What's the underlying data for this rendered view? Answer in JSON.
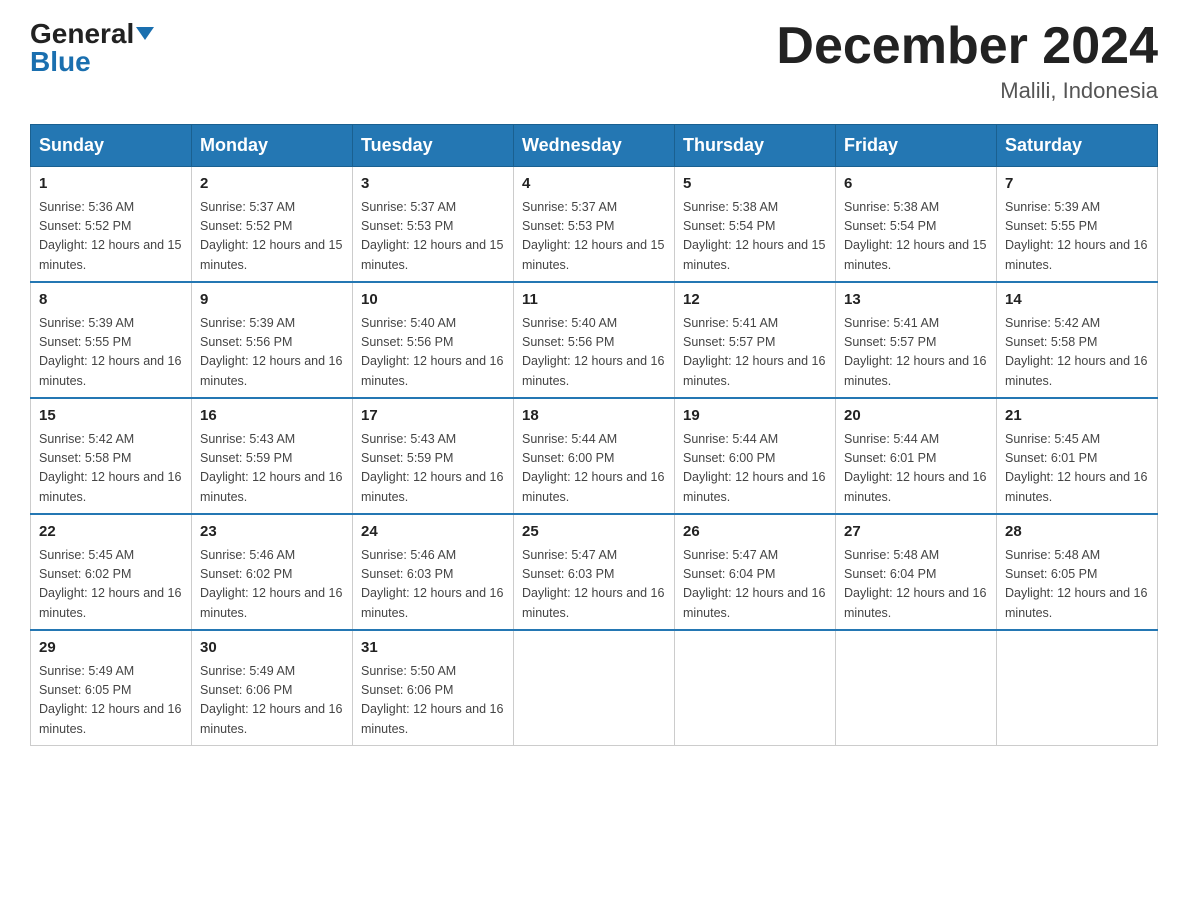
{
  "logo": {
    "line1": "General",
    "line2": "Blue"
  },
  "title": "December 2024",
  "subtitle": "Malili, Indonesia",
  "days_header": [
    "Sunday",
    "Monday",
    "Tuesday",
    "Wednesday",
    "Thursday",
    "Friday",
    "Saturday"
  ],
  "weeks": [
    [
      {
        "day": "1",
        "sunrise": "5:36 AM",
        "sunset": "5:52 PM",
        "daylight": "12 hours and 15 minutes."
      },
      {
        "day": "2",
        "sunrise": "5:37 AM",
        "sunset": "5:52 PM",
        "daylight": "12 hours and 15 minutes."
      },
      {
        "day": "3",
        "sunrise": "5:37 AM",
        "sunset": "5:53 PM",
        "daylight": "12 hours and 15 minutes."
      },
      {
        "day": "4",
        "sunrise": "5:37 AM",
        "sunset": "5:53 PM",
        "daylight": "12 hours and 15 minutes."
      },
      {
        "day": "5",
        "sunrise": "5:38 AM",
        "sunset": "5:54 PM",
        "daylight": "12 hours and 15 minutes."
      },
      {
        "day": "6",
        "sunrise": "5:38 AM",
        "sunset": "5:54 PM",
        "daylight": "12 hours and 15 minutes."
      },
      {
        "day": "7",
        "sunrise": "5:39 AM",
        "sunset": "5:55 PM",
        "daylight": "12 hours and 16 minutes."
      }
    ],
    [
      {
        "day": "8",
        "sunrise": "5:39 AM",
        "sunset": "5:55 PM",
        "daylight": "12 hours and 16 minutes."
      },
      {
        "day": "9",
        "sunrise": "5:39 AM",
        "sunset": "5:56 PM",
        "daylight": "12 hours and 16 minutes."
      },
      {
        "day": "10",
        "sunrise": "5:40 AM",
        "sunset": "5:56 PM",
        "daylight": "12 hours and 16 minutes."
      },
      {
        "day": "11",
        "sunrise": "5:40 AM",
        "sunset": "5:56 PM",
        "daylight": "12 hours and 16 minutes."
      },
      {
        "day": "12",
        "sunrise": "5:41 AM",
        "sunset": "5:57 PM",
        "daylight": "12 hours and 16 minutes."
      },
      {
        "day": "13",
        "sunrise": "5:41 AM",
        "sunset": "5:57 PM",
        "daylight": "12 hours and 16 minutes."
      },
      {
        "day": "14",
        "sunrise": "5:42 AM",
        "sunset": "5:58 PM",
        "daylight": "12 hours and 16 minutes."
      }
    ],
    [
      {
        "day": "15",
        "sunrise": "5:42 AM",
        "sunset": "5:58 PM",
        "daylight": "12 hours and 16 minutes."
      },
      {
        "day": "16",
        "sunrise": "5:43 AM",
        "sunset": "5:59 PM",
        "daylight": "12 hours and 16 minutes."
      },
      {
        "day": "17",
        "sunrise": "5:43 AM",
        "sunset": "5:59 PM",
        "daylight": "12 hours and 16 minutes."
      },
      {
        "day": "18",
        "sunrise": "5:44 AM",
        "sunset": "6:00 PM",
        "daylight": "12 hours and 16 minutes."
      },
      {
        "day": "19",
        "sunrise": "5:44 AM",
        "sunset": "6:00 PM",
        "daylight": "12 hours and 16 minutes."
      },
      {
        "day": "20",
        "sunrise": "5:44 AM",
        "sunset": "6:01 PM",
        "daylight": "12 hours and 16 minutes."
      },
      {
        "day": "21",
        "sunrise": "5:45 AM",
        "sunset": "6:01 PM",
        "daylight": "12 hours and 16 minutes."
      }
    ],
    [
      {
        "day": "22",
        "sunrise": "5:45 AM",
        "sunset": "6:02 PM",
        "daylight": "12 hours and 16 minutes."
      },
      {
        "day": "23",
        "sunrise": "5:46 AM",
        "sunset": "6:02 PM",
        "daylight": "12 hours and 16 minutes."
      },
      {
        "day": "24",
        "sunrise": "5:46 AM",
        "sunset": "6:03 PM",
        "daylight": "12 hours and 16 minutes."
      },
      {
        "day": "25",
        "sunrise": "5:47 AM",
        "sunset": "6:03 PM",
        "daylight": "12 hours and 16 minutes."
      },
      {
        "day": "26",
        "sunrise": "5:47 AM",
        "sunset": "6:04 PM",
        "daylight": "12 hours and 16 minutes."
      },
      {
        "day": "27",
        "sunrise": "5:48 AM",
        "sunset": "6:04 PM",
        "daylight": "12 hours and 16 minutes."
      },
      {
        "day": "28",
        "sunrise": "5:48 AM",
        "sunset": "6:05 PM",
        "daylight": "12 hours and 16 minutes."
      }
    ],
    [
      {
        "day": "29",
        "sunrise": "5:49 AM",
        "sunset": "6:05 PM",
        "daylight": "12 hours and 16 minutes."
      },
      {
        "day": "30",
        "sunrise": "5:49 AM",
        "sunset": "6:06 PM",
        "daylight": "12 hours and 16 minutes."
      },
      {
        "day": "31",
        "sunrise": "5:50 AM",
        "sunset": "6:06 PM",
        "daylight": "12 hours and 16 minutes."
      },
      null,
      null,
      null,
      null
    ]
  ]
}
